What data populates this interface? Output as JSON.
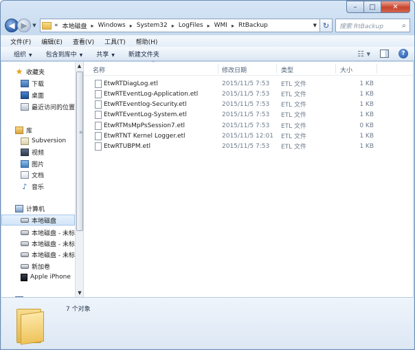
{
  "window": {
    "caption_buttons": {
      "minimize": "–",
      "maximize": "□",
      "close": "✕"
    }
  },
  "nav": {
    "back_glyph": "◀",
    "forward_glyph": "▶",
    "recent_glyph": "▼",
    "address_prefix": "«",
    "breadcrumb": [
      "本地磁盘",
      "Windows",
      "System32",
      "LogFiles",
      "WMI",
      "RtBackup"
    ],
    "breadcrumb_sep": "▸",
    "address_dropdown": "▼",
    "refresh_glyph": "↻",
    "search_placeholder": "搜索 RtBackup",
    "search_glyph": "⌕"
  },
  "menubar": [
    "文件(F)",
    "编辑(E)",
    "查看(V)",
    "工具(T)",
    "帮助(H)"
  ],
  "commandbar": {
    "organize": "组织",
    "include_library": "包含到库中",
    "share": "共享",
    "new_folder": "新建文件夹",
    "caret": "▼",
    "view_glyph": "☷ ▾",
    "help_glyph": "?"
  },
  "sidebar": {
    "favorites_header": "收藏夹",
    "favorites": [
      "下载",
      "桌面",
      "最近访问的位置"
    ],
    "libraries_header": "库",
    "libraries": [
      "Subversion",
      "视频",
      "图片",
      "文档",
      "音乐"
    ],
    "computer_header": "计算机",
    "computer": [
      "本地磁盘",
      "本地磁盘 - 未标",
      "本地磁盘 - 未标",
      "本地磁盘 - 未标",
      "新加卷",
      "Apple iPhone"
    ],
    "network_header": "网络",
    "selected": "本地磁盘",
    "scroll_up": "▲",
    "scroll_down": "▼",
    "scroll_grip": "≡"
  },
  "columns": {
    "name": "名称",
    "date": "修改日期",
    "type": "类型",
    "size": "大小",
    "sort_glyph": "^"
  },
  "files": [
    {
      "name": "EtwRTDiagLog.etl",
      "date": "2015/11/5 7:53",
      "type": "ETL 文件",
      "size": "1 KB"
    },
    {
      "name": "EtwRTEventLog-Application.etl",
      "date": "2015/11/5 7:53",
      "type": "ETL 文件",
      "size": "1 KB"
    },
    {
      "name": "EtwRTEventlog-Security.etl",
      "date": "2015/11/5 7:53",
      "type": "ETL 文件",
      "size": "1 KB"
    },
    {
      "name": "EtwRTEventLog-System.etl",
      "date": "2015/11/5 7:53",
      "type": "ETL 文件",
      "size": "1 KB"
    },
    {
      "name": "EtwRTMsMpPsSession7.etl",
      "date": "2015/11/5 7:53",
      "type": "ETL 文件",
      "size": "0 KB"
    },
    {
      "name": "EtwRTNT Kernel Logger.etl",
      "date": "2015/11/5 12:01",
      "type": "ETL 文件",
      "size": "1 KB"
    },
    {
      "name": "EtwRTUBPM.etl",
      "date": "2015/11/5 7:53",
      "type": "ETL 文件",
      "size": "1 KB"
    }
  ],
  "status": {
    "item_count": "7 个对象"
  }
}
